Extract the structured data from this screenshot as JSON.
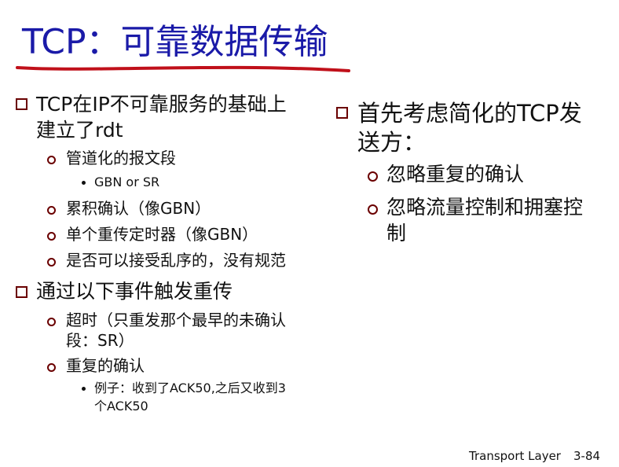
{
  "title": "TCP：可靠数据传输",
  "accent_color": "#1a1aa8",
  "underline_color": "#c0101a",
  "bullet_color": "#6a0000",
  "left_column": {
    "b1_line1": "TCP在IP不可靠服务的基础上",
    "b1_line2": "建立了rdt",
    "b1_s1": "管道化的报文段",
    "b1_s1_sub1": "GBN or SR",
    "b1_s2": "累积确认（像GBN）",
    "b1_s3": "单个重传定时器（像GBN）",
    "b1_s4": "是否可以接受乱序的，没有规范",
    "b2": "通过以下事件触发重传",
    "b2_s1_line1": "超时（只重发那个最早的未确认",
    "b2_s1_line2": "段：SR）",
    "b2_s2": "重复的确认",
    "b2_s2_sub1_line1": "例子：收到了ACK50,之后又收到3",
    "b2_s2_sub1_line2": "个ACK50"
  },
  "right_column": {
    "b1_line1": "首先考虑简化的TCP发",
    "b1_line2": "送方：",
    "s1": "忽略重复的确认",
    "s2_line1": "忽略流量控制和拥塞控",
    "s2_line2": "制"
  },
  "footer": {
    "label": "Transport Layer",
    "page": "3-84"
  }
}
